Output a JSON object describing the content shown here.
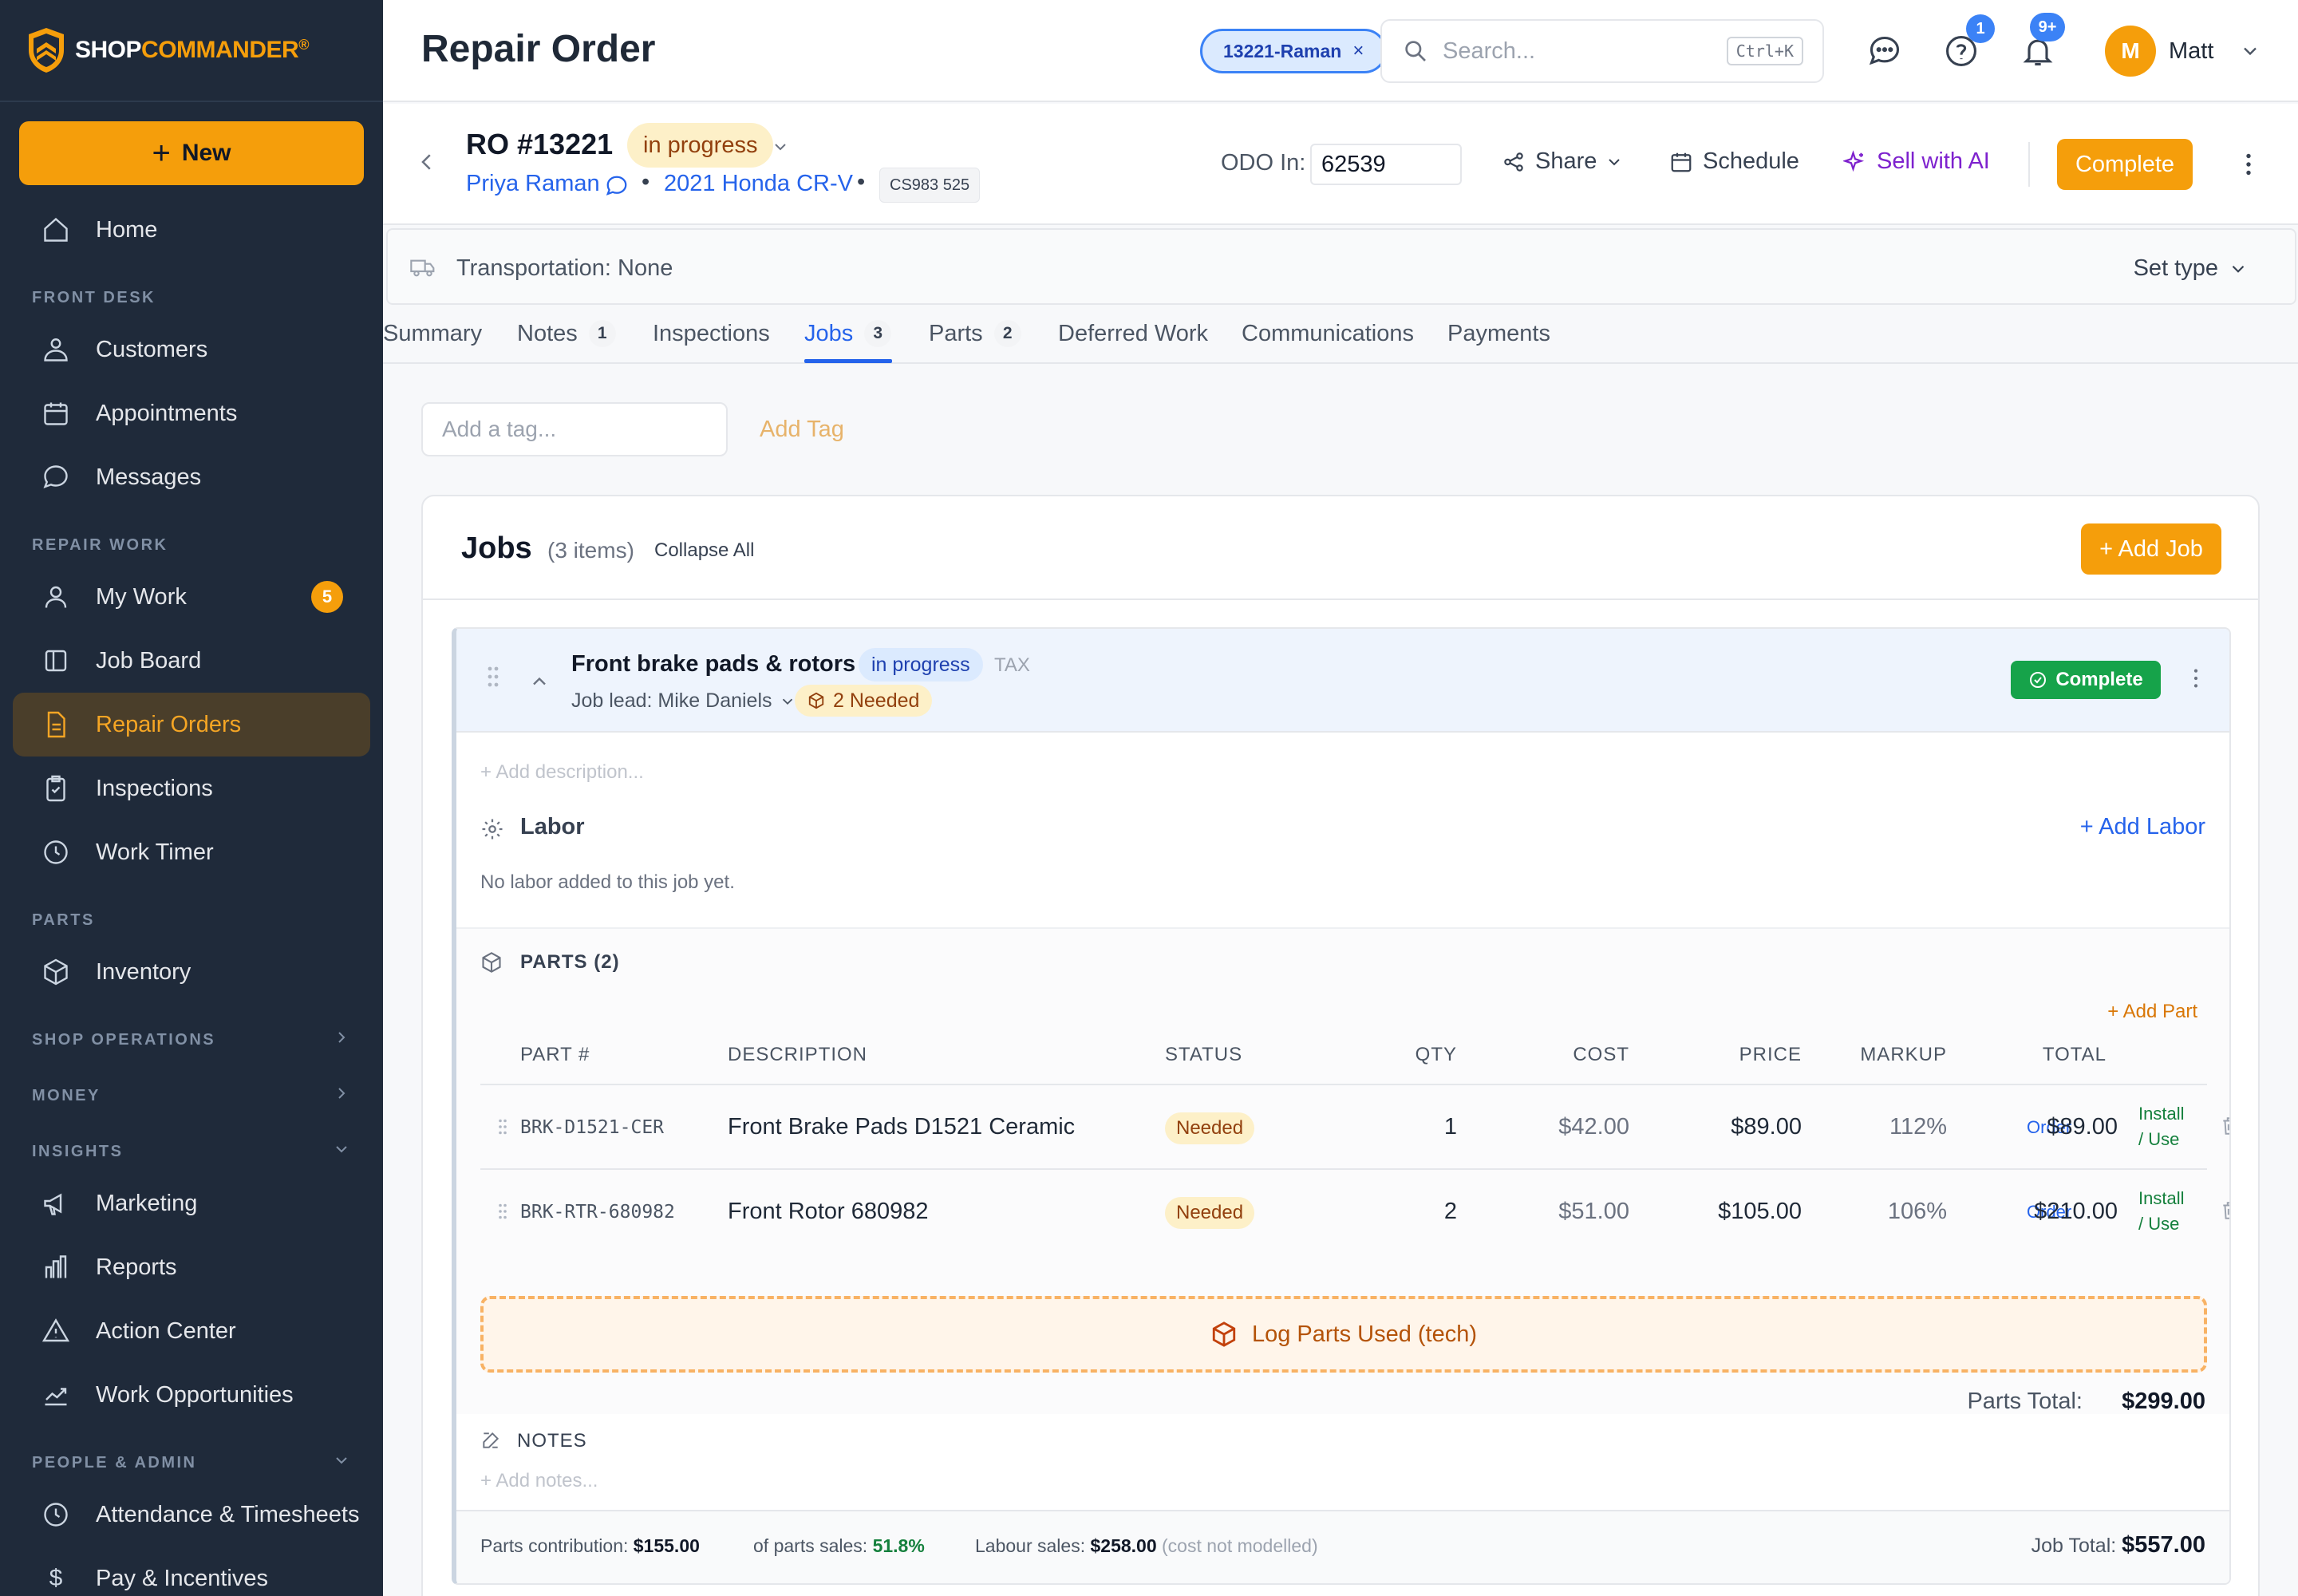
{
  "brand": {
    "name_part1": "SHOP",
    "name_part2": "COMMANDER",
    "reg": "®"
  },
  "sidebar": {
    "new_label": "New",
    "sections": {
      "front_desk": "FRONT DESK",
      "repair_work": "REPAIR WORK",
      "parts": "PARTS",
      "shop_operations": "SHOP OPERATIONS",
      "money": "MONEY",
      "insights": "INSIGHTS",
      "people_admin": "PEOPLE & ADMIN"
    },
    "items": {
      "home": "Home",
      "customers": "Customers",
      "appointments": "Appointments",
      "messages": "Messages",
      "my_work": "My Work",
      "my_work_badge": "5",
      "job_board": "Job Board",
      "repair_orders": "Repair Orders",
      "inspections": "Inspections",
      "work_timer": "Work Timer",
      "inventory": "Inventory",
      "marketing": "Marketing",
      "reports": "Reports",
      "action_center": "Action Center",
      "work_opportunities": "Work Opportunities",
      "attendance": "Attendance & Timesheets",
      "pay": "Pay & Incentives"
    }
  },
  "topbar": {
    "title": "Repair Order",
    "ro_chip": "13221-Raman",
    "ro_chip_close": "×",
    "search_placeholder": "Search...",
    "search_shortcut": "Ctrl+K",
    "help_badge": "1",
    "notif_badge": "9+",
    "user_initial": "M",
    "user_name": "Matt"
  },
  "ro": {
    "number": "RO #13221",
    "status": "in progress",
    "customer": "Priya Raman",
    "separator": "•",
    "vehicle": "2021 Honda CR-V",
    "plate": "CS983 525",
    "odo_label": "ODO In:",
    "odo_value": "62539",
    "share": "Share",
    "schedule": "Schedule",
    "sell_ai": "Sell with AI",
    "complete": "Complete"
  },
  "transport": {
    "text": "Transportation: None",
    "set_type": "Set type"
  },
  "tabs": [
    {
      "label": "Summary",
      "count": ""
    },
    {
      "label": "Notes",
      "count": "1"
    },
    {
      "label": "Inspections",
      "count": ""
    },
    {
      "label": "Jobs",
      "count": "3"
    },
    {
      "label": "Parts",
      "count": "2"
    },
    {
      "label": "Deferred Work",
      "count": ""
    },
    {
      "label": "Communications",
      "count": ""
    },
    {
      "label": "Payments",
      "count": ""
    }
  ],
  "tags": {
    "placeholder": "Add a tag...",
    "add_label": "Add Tag"
  },
  "jobs": {
    "title": "Jobs",
    "count": "(3 items)",
    "collapse_all": "Collapse All",
    "add_job": "+ Add Job"
  },
  "job": {
    "title": "Front brake pads & rotors",
    "status": "in progress",
    "tax": "TAX",
    "lead": "Job lead: Mike Daniels",
    "needed": "2 Needed",
    "complete": "Complete",
    "add_description": "+ Add description...",
    "labor_title": "Labor",
    "add_labor": "+ Add Labor",
    "no_labor": "No labor added to this job yet.",
    "parts_title": "PARTS (2)",
    "add_part": "+ Add Part",
    "columns": [
      "PART #",
      "DESCRIPTION",
      "STATUS",
      "QTY",
      "COST",
      "PRICE",
      "MARKUP",
      "TOTAL"
    ],
    "parts": [
      {
        "part_no": "BRK-D1521-CER",
        "description": "Front Brake Pads D1521 Ceramic",
        "status": "Needed",
        "qty": "1",
        "cost": "$42.00",
        "price": "$89.00",
        "markup": "112%",
        "order": "Order",
        "total": "$89.00",
        "install": "Install",
        "use": "/ Use"
      },
      {
        "part_no": "BRK-RTR-680982",
        "description": "Front Rotor 680982",
        "status": "Needed",
        "qty": "2",
        "cost": "$51.00",
        "price": "$105.00",
        "markup": "106%",
        "order": "Order",
        "total": "$210.00",
        "install": "Install",
        "use": "/ Use"
      }
    ],
    "log_parts": "Log Parts Used (tech)",
    "parts_total_label": "Parts Total:",
    "parts_total_value": "$299.00",
    "notes_title": "NOTES",
    "add_notes": "+ Add notes...",
    "footer": {
      "parts_contribution_label": "Parts contribution:",
      "parts_contribution_value": "$155.00",
      "of_parts_sales_label": "of parts sales:",
      "of_parts_sales_value": "51.8%",
      "labour_sales_label": "Labour sales:",
      "labour_sales_value": "$258.00",
      "cost_note": "(cost not modelled)",
      "job_total_label": "Job Total:",
      "job_total_value": "$557.00"
    }
  },
  "colors": {
    "accent": "#f59e0b",
    "sidebar": "#1f2a3a",
    "link": "#2563eb",
    "success": "#16a34a"
  }
}
